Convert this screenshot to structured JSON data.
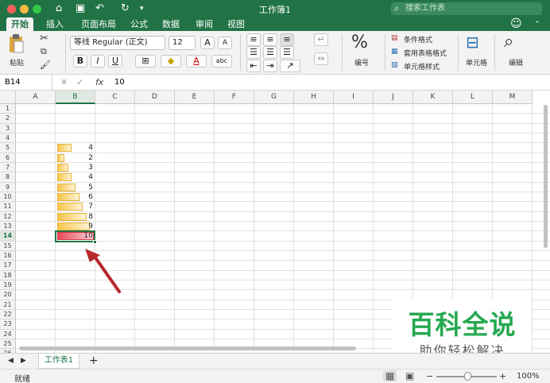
{
  "window": {
    "title": "工作簿1",
    "search_placeholder": "搜索工作表"
  },
  "tabs": [
    "开始",
    "插入",
    "页面布局",
    "公式",
    "数据",
    "审阅",
    "视图"
  ],
  "ribbon": {
    "paste": "粘贴",
    "font_name": "等线 Regular (正文)",
    "font_size": "12",
    "bold": "B",
    "italic": "I",
    "underline": "U",
    "number_symbol": "%",
    "number_label": "编号",
    "cond_format": "条件格式",
    "table_format": "套用表格格式",
    "cell_style": "单元格样式",
    "cells": "单元格",
    "edit": "编辑",
    "grow_font": "A",
    "shrink_font": "A",
    "font_color": "A",
    "abc": "abc"
  },
  "formula": {
    "namebox": "B14",
    "fx": "fx",
    "value": "10"
  },
  "columns": [
    "A",
    "B",
    "C",
    "D",
    "E",
    "F",
    "G",
    "H",
    "I",
    "J",
    "K",
    "L",
    "M"
  ],
  "rows": [
    "1",
    "2",
    "3",
    "4",
    "5",
    "6",
    "7",
    "8",
    "9",
    "10",
    "11",
    "12",
    "13",
    "14",
    "15",
    "16",
    "17",
    "18",
    "19",
    "20",
    "21",
    "22",
    "23",
    "24",
    "25",
    "26"
  ],
  "selected": {
    "column": "B",
    "row": "14"
  },
  "cells": [
    {
      "row": "5",
      "value": "4"
    },
    {
      "row": "6",
      "value": "2"
    },
    {
      "row": "7",
      "value": "3"
    },
    {
      "row": "8",
      "value": "4"
    },
    {
      "row": "9",
      "value": "5"
    },
    {
      "row": "10",
      "value": "6"
    },
    {
      "row": "11",
      "value": "7"
    },
    {
      "row": "12",
      "value": "8"
    },
    {
      "row": "13",
      "value": "9"
    },
    {
      "row": "14",
      "value": "10"
    }
  ],
  "databar": {
    "max": 10,
    "color": "#f7c64a",
    "highlight_color": "#e8475a"
  },
  "sheet": {
    "name": "工作表1",
    "add": "+"
  },
  "status": {
    "ready": "就绪",
    "zoom": "100%",
    "minus": "−",
    "plus": "+"
  },
  "watermark": {
    "line1": "百科全说",
    "line2": "助你轻松解决"
  }
}
